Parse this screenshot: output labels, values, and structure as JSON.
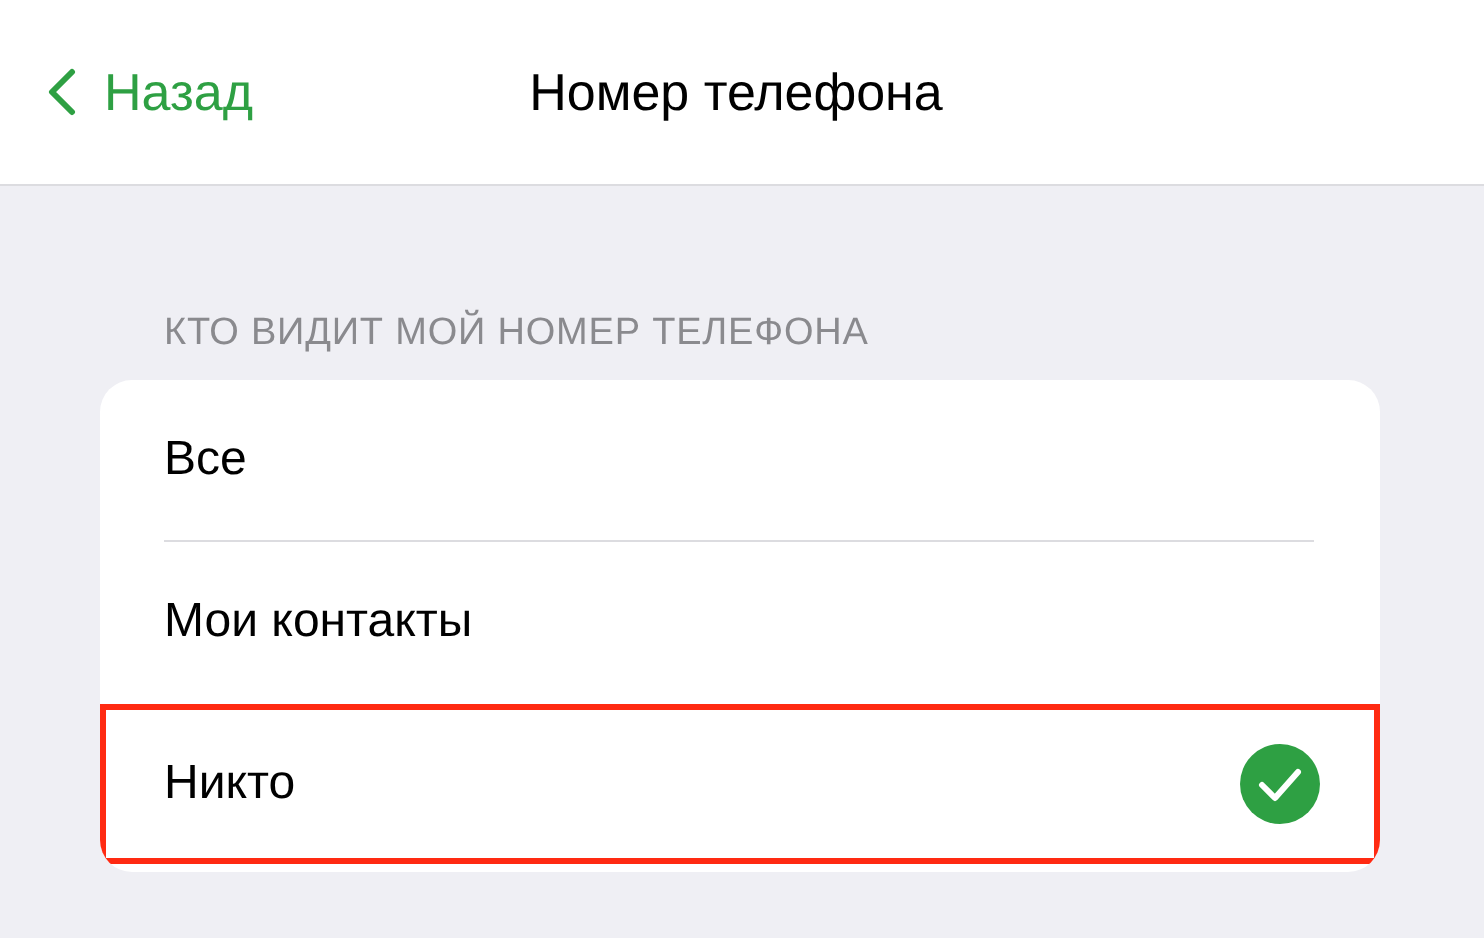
{
  "nav": {
    "back": "Назад",
    "title": "Номер телефона"
  },
  "section": {
    "header": "КТО ВИДИТ МОЙ НОМЕР ТЕЛЕФОНА",
    "options": [
      {
        "label": "Все",
        "selected": false,
        "highlighted": false
      },
      {
        "label": "Мои контакты",
        "selected": false,
        "highlighted": false
      },
      {
        "label": "Никто",
        "selected": true,
        "highlighted": true
      }
    ]
  }
}
